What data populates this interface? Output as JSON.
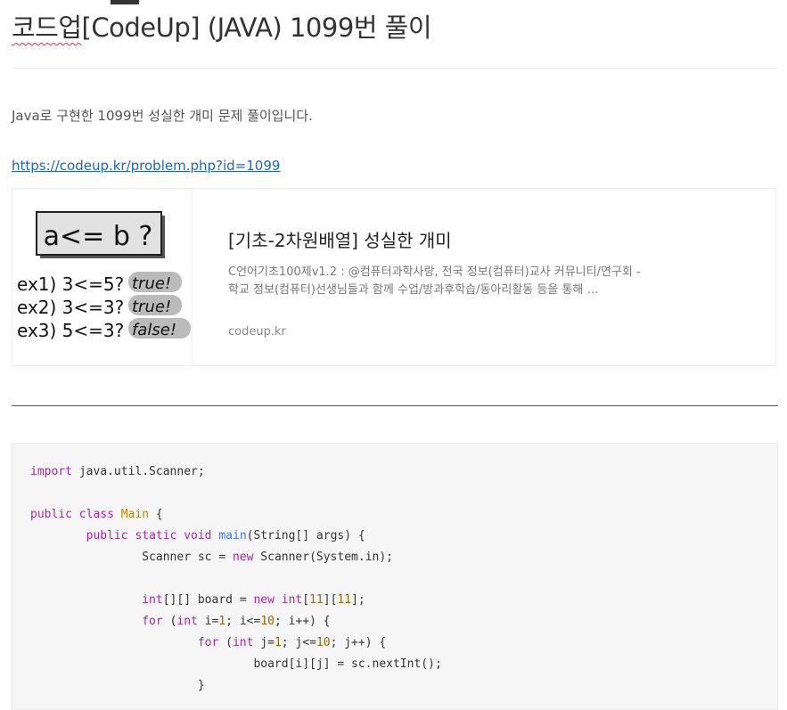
{
  "post": {
    "title_prefix": "코드업",
    "title_rest": "[CodeUp] (JAVA) 1099번 풀이",
    "description": "Java로 구현한 1099번 성실한 개미 문제 풀이입니다.",
    "link_url": "https://codeup.kr/problem.php?id=1099"
  },
  "card": {
    "title": "[기초-2차원배열] 성실한 개미",
    "description": "C언어기초100제v1.2 : @컴퓨터과학사랑, 전국 정보(컴퓨터)교사 커뮤니티/연구회 - 학교 정보(컴퓨터)선생님들과 함께 수업/방과후학습/동아리활동 등을 통해 …",
    "host": "codeup.kr",
    "thumb": {
      "question": "a<= b ?",
      "ex1": "ex1) 3<=5?",
      "ex1_result": "true!",
      "ex2": "ex2) 3<=3?",
      "ex2_result": "true!",
      "ex3": "ex3) 5<=3?",
      "ex3_result": "false!"
    }
  },
  "code": {
    "l1_kw": "import",
    "l1_rest": " java.util.Scanner;",
    "l3_kw1": "public",
    "l3_kw2": "class",
    "l3_cls": "Main",
    "l3_rest": " {",
    "l4_kw": "public static void",
    "l4_fn": "main",
    "l4_rest": "(String[] args) {",
    "l5_a": "Scanner sc = ",
    "l5_kw": "new",
    "l5_b": " Scanner(System.in);",
    "l7_kw1": "int",
    "l7_a": "[][] board = ",
    "l7_kw2": "new",
    "l7_kw3": "int",
    "l7_n1": "11",
    "l7_n2": "11",
    "l8_kw1": "for",
    "l8_kw2": "int",
    "l8_a": " i=",
    "l8_n1": "1",
    "l8_b": "; i<=",
    "l8_n2": "10",
    "l8_c": "; i++) {",
    "l9_kw1": "for",
    "l9_kw2": "int",
    "l9_a": " j=",
    "l9_n1": "1",
    "l9_b": "; j<=",
    "l9_n2": "10",
    "l9_c": "; j++) {",
    "l10": "board[i][j] = sc.nextInt();",
    "l11": "}"
  }
}
